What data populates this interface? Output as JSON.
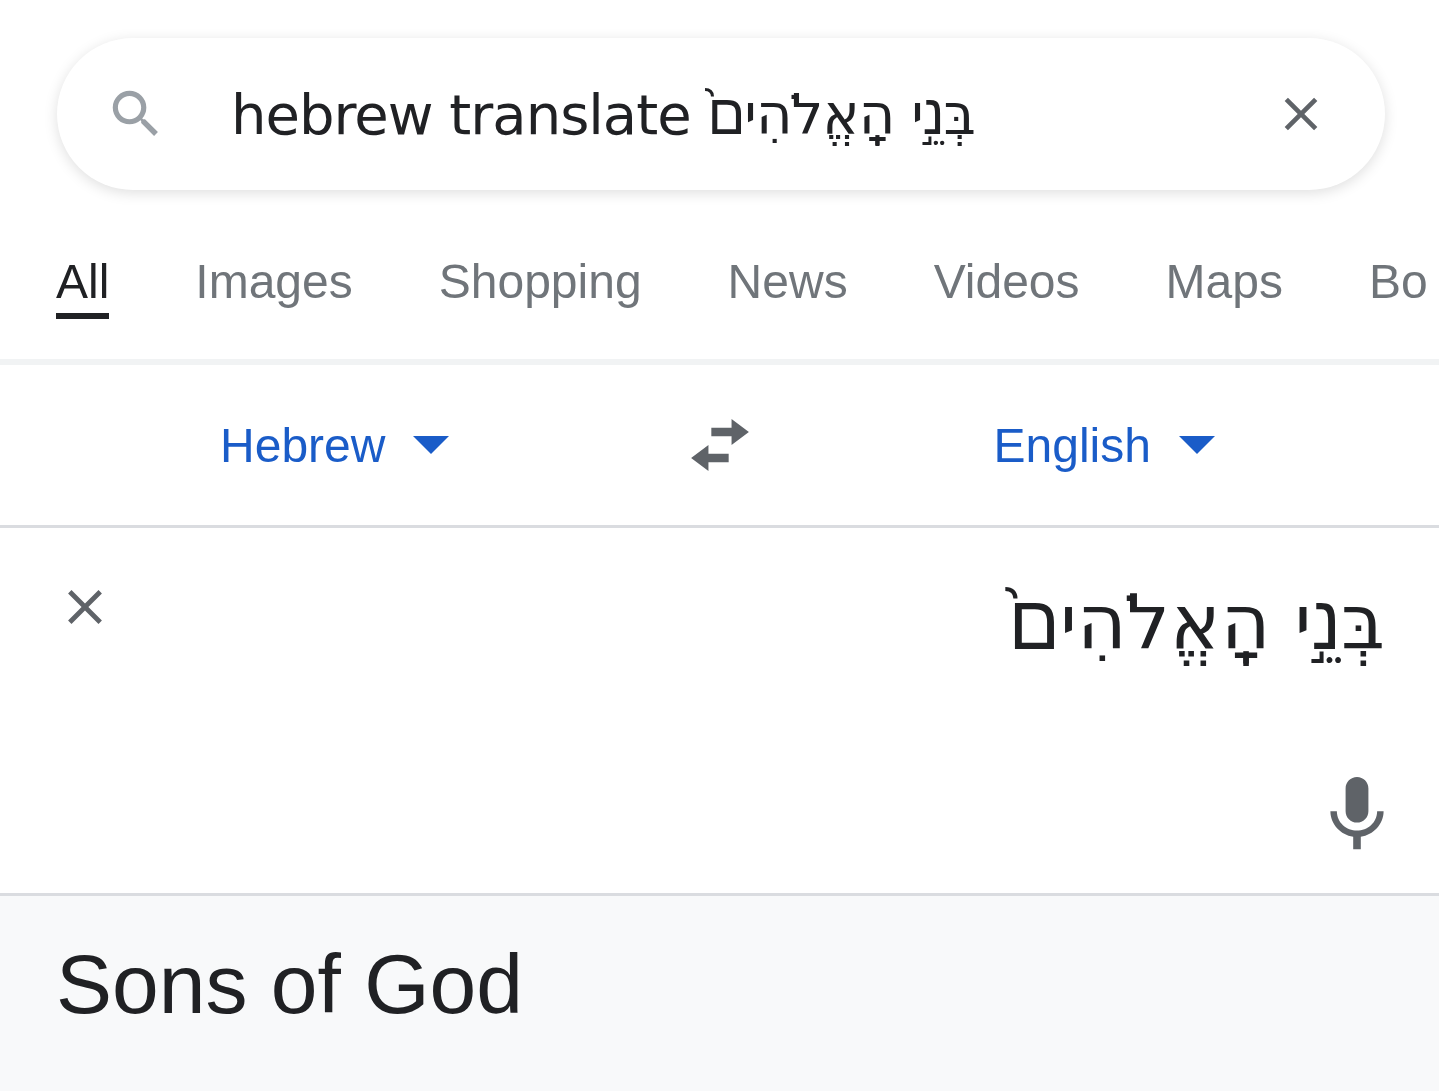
{
  "search": {
    "value": "hebrew translate בְּנֵ֣י הָֽאֱלֹהִים֙"
  },
  "tabs": [
    {
      "label": "All",
      "selected": true
    },
    {
      "label": "Images",
      "selected": false
    },
    {
      "label": "Shopping",
      "selected": false
    },
    {
      "label": "News",
      "selected": false
    },
    {
      "label": "Videos",
      "selected": false
    },
    {
      "label": "Maps",
      "selected": false
    },
    {
      "label": "Bo",
      "selected": false
    }
  ],
  "translator": {
    "source_language": "Hebrew",
    "target_language": "English",
    "source_text": "בְּנֵ֣י הָֽאֱלֹהִים֙",
    "result": "Sons of God"
  }
}
